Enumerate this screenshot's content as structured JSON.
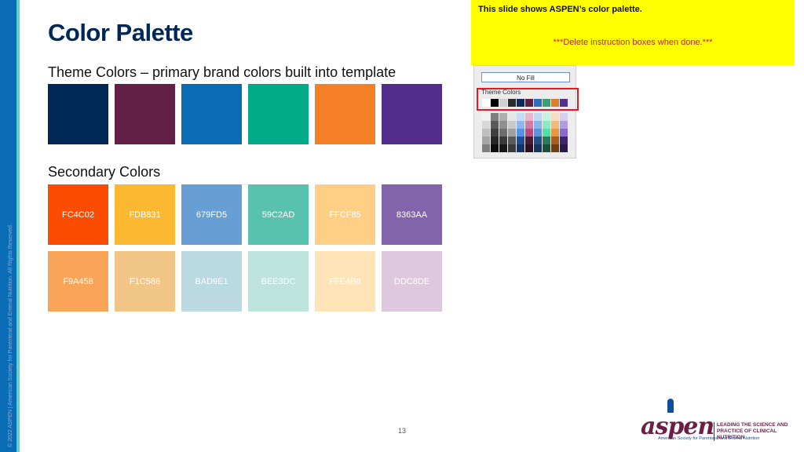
{
  "slide": {
    "title": "Color Palette",
    "theme_heading": "Theme Colors – primary brand colors built into template",
    "secondary_heading": "Secondary Colors",
    "page_number": "13",
    "copyright": "© 2022 ASPEN | American Society for Parenteral and Enteral Nutrition. All Rights Reserved."
  },
  "theme_colors": [
    {
      "name": "navy",
      "hex": "#002856"
    },
    {
      "name": "plum",
      "hex": "#632046"
    },
    {
      "name": "blue",
      "hex": "#0b6cb6"
    },
    {
      "name": "teal",
      "hex": "#00aa88"
    },
    {
      "name": "orange",
      "hex": "#f47f27"
    },
    {
      "name": "purple",
      "hex": "#532d8c"
    }
  ],
  "secondary_colors_row1": [
    {
      "label": "FC4C02",
      "hex": "#FC4C02"
    },
    {
      "label": "FDB831",
      "hex": "#FDB831"
    },
    {
      "label": "679FD5",
      "hex": "#679FD5"
    },
    {
      "label": "59C2AD",
      "hex": "#59C2AD"
    },
    {
      "label": "FFCF85",
      "hex": "#FFCF85"
    },
    {
      "label": "8363AA",
      "hex": "#8363AA"
    }
  ],
  "secondary_colors_row2": [
    {
      "label": "F9A458",
      "hex": "#F9A458"
    },
    {
      "label": "F1C586",
      "hex": "#F1C586"
    },
    {
      "label": "BAD9E1",
      "hex": "#BAD9E1"
    },
    {
      "label": "BEE3DC",
      "hex": "#BEE3DC"
    },
    {
      "label": "FFE4B8",
      "hex": "#FFE4B8"
    },
    {
      "label": "DDC8DE",
      "hex": "#DDC8DE"
    }
  ],
  "instructions": {
    "title": "This slide shows ASPEN’s color palette.",
    "note": "***Delete instruction boxes when done.***"
  },
  "color_picker": {
    "no_fill_label": "No Fill",
    "theme_colors_label": "Theme Colors",
    "theme_row": [
      "#ffffff",
      "#000000",
      "#d0d0d0",
      "#2b2b2b",
      "#0e2a5c",
      "#5e1f45",
      "#2e6fbb",
      "#3aa07c",
      "#e07d2e",
      "#53318f"
    ],
    "shade_columns": [
      [
        "#f2f2f2",
        "#d8d8d8",
        "#bfbfbf",
        "#a5a5a5",
        "#7f7f7f"
      ],
      [
        "#7f7f7f",
        "#595959",
        "#3f3f3f",
        "#262626",
        "#0c0c0c"
      ],
      [
        "#aeaeae",
        "#8f8f8f",
        "#6d6d6d",
        "#3a3a3a",
        "#171717"
      ],
      [
        "#e7e7e7",
        "#c8c8c8",
        "#a0a0a0",
        "#5a5a5a",
        "#3a3a3a"
      ],
      [
        "#c6dbf8",
        "#8fb6ee",
        "#5591e5",
        "#1f4e99",
        "#133364"
      ],
      [
        "#e6b7cf",
        "#d07ca5",
        "#b84a7f",
        "#4a1836",
        "#2e0f22"
      ],
      [
        "#c0d8f2",
        "#89b6e6",
        "#5796da",
        "#234f88",
        "#17365c"
      ],
      [
        "#c5f3e1",
        "#8ce9c6",
        "#55dfaa",
        "#2a7a5c",
        "#1b513d"
      ],
      [
        "#f8dcc0",
        "#f2b980",
        "#eb9641",
        "#a85c1e",
        "#713e14"
      ],
      [
        "#d8cdee",
        "#b29cdd",
        "#8b6acb",
        "#3e246b",
        "#291848"
      ]
    ]
  },
  "logo": {
    "wordmark": "aspen",
    "tagline_line1": "LEADING THE SCIENCE AND",
    "tagline_line2": "PRACTICE OF CLINICAL NUTRITION",
    "subtitle": "American Society for Parenteral and Enteral Nutrition"
  }
}
